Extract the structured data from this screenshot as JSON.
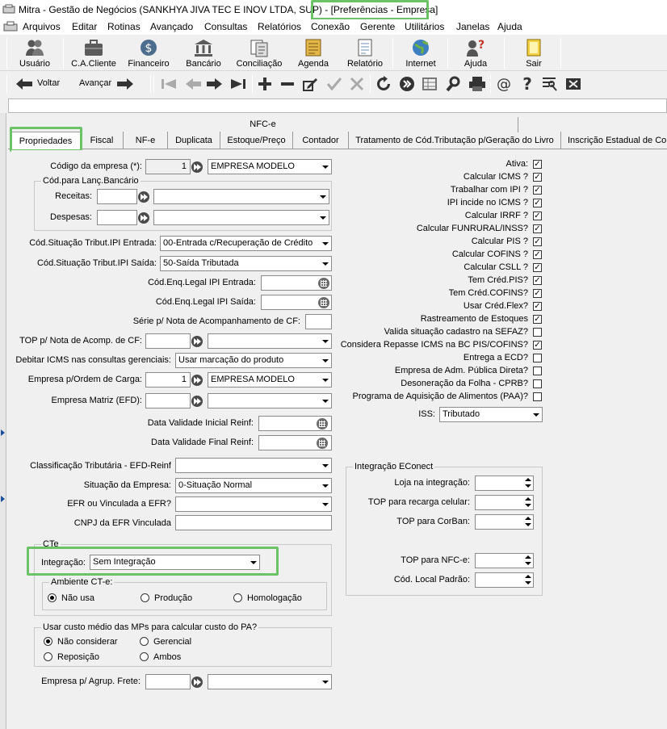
{
  "window": {
    "title_main": "Mitra - Gestão de Negócios (SANKHYA JIVA TEC E INOV LTDA, SUP) - ",
    "title_screen": "[Preferências - Empresa]"
  },
  "menu": [
    "Arquivos",
    "Editar",
    "Rotinas",
    "Avançado",
    "Consultas",
    "Relatórios",
    "Conexão",
    "Gerente",
    "Utilitários",
    "Janelas",
    "Ajuda"
  ],
  "toolbar": {
    "usuario": "Usuário",
    "ccliente": "C.A.Cliente",
    "financeiro": "Financeiro",
    "bancario": "Bancário",
    "conciliacao": "Conciliação",
    "agenda": "Agenda",
    "relatorio": "Relatório",
    "internet": "Internet",
    "ajuda": "Ajuda",
    "sair": "Sair"
  },
  "nav": {
    "voltar": "Voltar",
    "avancar": "Avançar"
  },
  "tab_group": "NFC-e",
  "tabs": [
    "Propriedades",
    "Fiscal",
    "NF-e",
    "Duplicata",
    "Estoque/Preço",
    "Contador",
    "Tratamento de Cód.Tributação p/Geração do Livro",
    "Inscrição Estadual de Cor"
  ],
  "form": {
    "codigo_label": "Código da empresa (*):",
    "codigo_value": "1",
    "codigo_name": "EMPRESA MODELO",
    "banc_group": "Cód.para Lanç.Bancário",
    "receitas": "Receitas:",
    "despesas": "Despesas:",
    "ipi_entrada_label": "Cód.Situação Tribut.IPI Entrada:",
    "ipi_entrada_value": "00-Entrada c/Recuperação de Crédito",
    "ipi_saida_label": "Cód.Situação Tribut.IPI Saída:",
    "ipi_saida_value": "50-Saída Tributada",
    "enq_entrada": "Cód.Enq.Legal IPI Entrada:",
    "enq_saida": "Cód.Enq.Legal IPI Saída:",
    "serie_nota": "Série p/ Nota de Acompanhamento de CF:",
    "top_nota": "TOP p/ Nota de Acomp. de CF:",
    "debitar_label": "Debitar ICMS nas consultas gerenciais:",
    "debitar_value": "Usar marcação do produto",
    "ordem_label": "Empresa p/Ordem de Carga:",
    "ordem_value": "1",
    "ordem_name": "EMPRESA MODELO",
    "matriz_label": "Empresa Matriz (EFD):",
    "val_ini": "Data Validade Inicial Reinf:",
    "val_fim": "Data Validade Final Reinf:",
    "class_trib": "Classificação Tributária - EFD-Reinf",
    "situacao_label": "Situação da Empresa:",
    "situacao_value": "0-Situação Normal",
    "efr_label": "EFR ou Vinculada a EFR?",
    "cnpj_efr": "CNPJ da EFR Vinculada",
    "cte_group": "CTe",
    "integracao_label": "Integração:",
    "integracao_value": "Sem Integração",
    "ambiente_group": "Ambiente CT-e:",
    "amb_nao": "Não usa",
    "amb_prod": "Produção",
    "amb_homol": "Homologação",
    "custo_group": "Usar custo médio das MPs para calcular custo do PA?",
    "c_nao": "Não considerar",
    "c_ger": "Gerencial",
    "c_rep": "Reposição",
    "c_amb": "Ambos",
    "agrup_label": "Empresa p/ Agrup. Frete:"
  },
  "checks": [
    {
      "label": "Ativa:",
      "checked": true
    },
    {
      "label": "Calcular ICMS ?",
      "checked": true
    },
    {
      "label": "Trabalhar com IPI ?",
      "checked": true
    },
    {
      "label": "IPI incide no ICMS ?",
      "checked": true
    },
    {
      "label": "Calcular IRRF ?",
      "checked": true
    },
    {
      "label": "Calcular FUNRURAL/INSS?",
      "checked": true
    },
    {
      "label": "Calcular PIS ?",
      "checked": true
    },
    {
      "label": "Calcular COFINS ?",
      "checked": true
    },
    {
      "label": "Calcular CSLL ?",
      "checked": true
    },
    {
      "label": "Tem Créd.PIS?",
      "checked": true
    },
    {
      "label": "Tem Créd.COFINS?",
      "checked": true
    },
    {
      "label": "Usar Créd.Flex?",
      "checked": true
    },
    {
      "label": "Rastreamento de Estoques",
      "checked": true
    },
    {
      "label": "Valida situação cadastro na SEFAZ?",
      "checked": false
    },
    {
      "label": "Considera Repasse ICMS na BC PIS/COFINS?",
      "checked": true
    },
    {
      "label": "Entrega a ECD?",
      "checked": false
    },
    {
      "label": "Empresa de Adm. Pública Direta?",
      "checked": false
    },
    {
      "label": "Desoneração da Folha - CPRB?",
      "checked": false
    },
    {
      "label": "Programa de Aquisição de Alimentos (PAA)?",
      "checked": false
    }
  ],
  "iss": {
    "label": "ISS:",
    "value": "Tributado"
  },
  "econect": {
    "group": "Integração EConect",
    "loja": "Loja na integração:",
    "recarga": "TOP para recarga celular:",
    "corban": "TOP para CorBan:",
    "nfce": "TOP para NFC-e:",
    "local": "Cód. Local Padrão:"
  }
}
